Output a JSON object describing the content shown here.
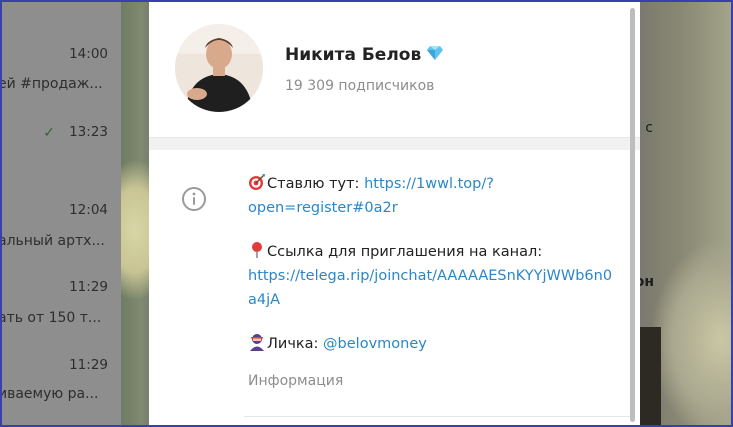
{
  "chat_list": {
    "times": [
      "14:00",
      "13:23",
      "12:04",
      "11:29",
      "11:29"
    ],
    "snippets": [
      "ей #продаж...",
      "альный артх...",
      "ать от 150 т...",
      "иваемую ра..."
    ]
  },
  "background": {
    "right_text_1": "с",
    "right_text_2": "он"
  },
  "channel": {
    "name": "Никита Белов",
    "subscribers": "19 309 подписчиков",
    "about": {
      "line1_text": "Ставлю тут: ",
      "line1_link": "https://1wwl.top/?open=register#0a2r",
      "line2_text": "Ссылка для приглашения на канал:",
      "line2_link": "https://telega.rip/joinchat/AAAAAESnKYYjWWb6n0a4jA",
      "line3_text": "Личка: ",
      "line3_link": "@belovmoney"
    },
    "caption": "Информация"
  },
  "icons": {
    "info": "info-icon",
    "verified": "diamond-icon",
    "target": "target-icon",
    "pin": "pin-icon",
    "person": "ninja-icon"
  },
  "colors": {
    "link": "#2a87c8",
    "muted": "#8d8d8d",
    "frame": "#3a3fb0"
  }
}
